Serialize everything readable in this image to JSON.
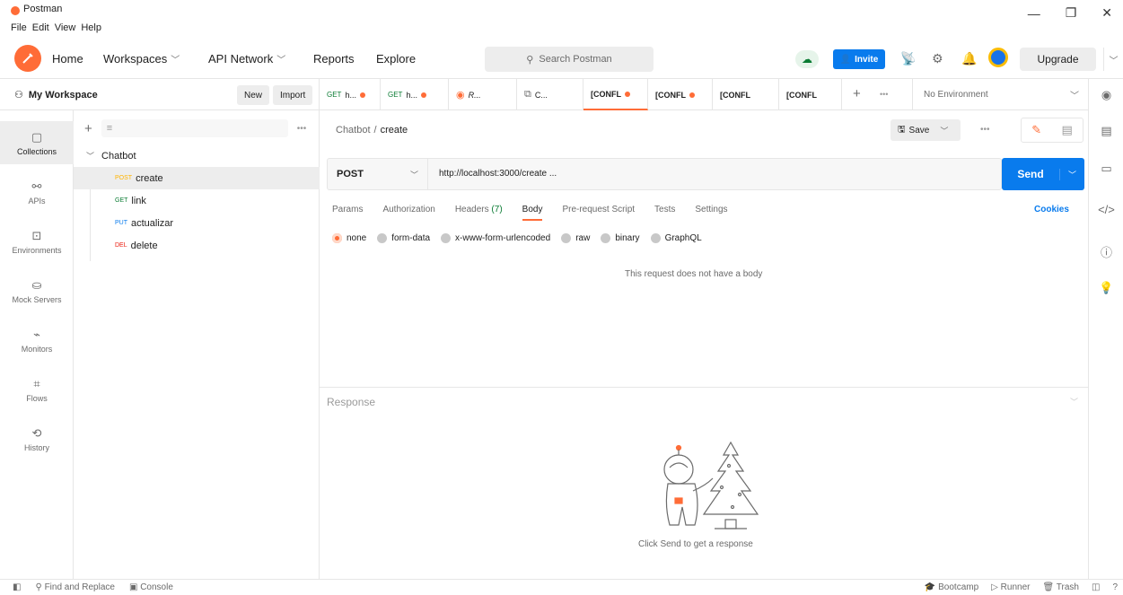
{
  "window": {
    "title": "Postman",
    "menu": [
      "File",
      "Edit",
      "View",
      "Help"
    ],
    "controls": {
      "minimize": "—",
      "maximize": "❐",
      "close": "✕"
    }
  },
  "header": {
    "nav": [
      {
        "label": "Home",
        "dropdown": false
      },
      {
        "label": "Workspaces",
        "dropdown": true
      },
      {
        "label": "API Network",
        "dropdown": true
      },
      {
        "label": "Reports",
        "dropdown": false
      },
      {
        "label": "Explore",
        "dropdown": false
      }
    ],
    "search_placeholder": "Search Postman",
    "invite_label": "Invite",
    "upgrade_label": "Upgrade"
  },
  "workspace": {
    "name": "My Workspace",
    "new_label": "New",
    "import_label": "Import"
  },
  "tabs": [
    {
      "method": "GET",
      "label": "h...",
      "dirty": true
    },
    {
      "method": "GET",
      "label": "h...",
      "dirty": true
    },
    {
      "method": "",
      "label": "R...",
      "dirty": false
    },
    {
      "method": "",
      "label": "C...",
      "dirty": false
    },
    {
      "method": "",
      "label": "[CONFL",
      "dirty": true,
      "active": true
    },
    {
      "method": "",
      "label": "[CONFL",
      "dirty": true
    },
    {
      "method": "",
      "label": "[CONFL",
      "dirty": false
    },
    {
      "method": "",
      "label": "[CONFL",
      "dirty": false
    }
  ],
  "environment": {
    "selected": "No Environment"
  },
  "rail": [
    {
      "label": "Collections",
      "icon": "collections-icon",
      "active": true
    },
    {
      "label": "APIs",
      "icon": "apis-icon"
    },
    {
      "label": "Environments",
      "icon": "environments-icon"
    },
    {
      "label": "Mock Servers",
      "icon": "mock-servers-icon"
    },
    {
      "label": "Monitors",
      "icon": "monitors-icon"
    },
    {
      "label": "Flows",
      "icon": "flows-icon"
    },
    {
      "label": "History",
      "icon": "history-icon"
    }
  ],
  "collections": {
    "folder": "Chatbot",
    "requests": [
      {
        "method": "POST",
        "name": "create",
        "selected": true
      },
      {
        "method": "GET",
        "name": "link"
      },
      {
        "method": "PUT",
        "name": "actualizar"
      },
      {
        "method": "DEL",
        "name": "delete"
      }
    ]
  },
  "request": {
    "breadcrumb": {
      "parent": "Chatbot",
      "separator": "/",
      "current": "create"
    },
    "save_label": "Save",
    "method": "POST",
    "url": "http://localhost:3000/create ...",
    "send_label": "Send",
    "tabs": {
      "params": "Params",
      "authorization": "Authorization",
      "headers": "Headers",
      "headers_count": "(7)",
      "body": "Body",
      "prerequest": "Pre-request Script",
      "tests": "Tests",
      "settings": "Settings"
    },
    "cookies_label": "Cookies",
    "body_options": [
      "none",
      "form-data",
      "x-www-form-urlencoded",
      "raw",
      "binary",
      "GraphQL"
    ],
    "body_selected": "none",
    "no_body_text": "This request does not have a body"
  },
  "response": {
    "label": "Response",
    "hint": "Click Send to get a response"
  },
  "statusbar": {
    "find_replace": "Find and Replace",
    "console": "Console",
    "bootcamp": "Bootcamp",
    "runner": "Runner",
    "trash": "Trash"
  },
  "colors": {
    "brand": "#ff6c37",
    "primary": "#097bed",
    "get": "#0a7b33",
    "post": "#ffb400",
    "put": "#097bed",
    "delete": "#eb2013"
  }
}
